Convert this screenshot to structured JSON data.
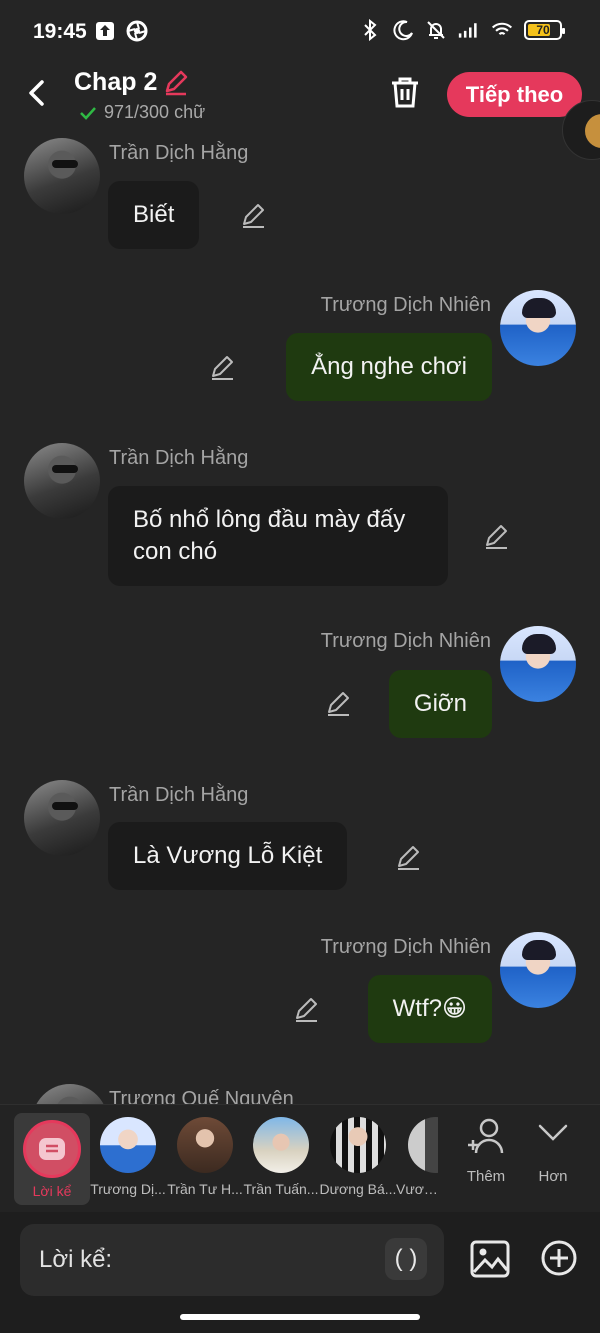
{
  "status_bar": {
    "time": "19:45",
    "battery": "70",
    "left_icons": [
      "upload-box-icon",
      "aperture-icon"
    ],
    "right_icons": [
      "bluetooth-icon",
      "moon-icon",
      "bell-off-icon",
      "signal-icon",
      "wifi-icon",
      "battery-icon"
    ]
  },
  "header": {
    "title": "Chap 2",
    "word_count": "971/300 chữ",
    "next_button": "Tiếp theo",
    "accent_color": "#e5395c"
  },
  "messages": [
    {
      "sender": "Trần Dịch Hằng",
      "side": "left",
      "text": "Biết"
    },
    {
      "sender": "Trương Dịch Nhiên",
      "side": "right",
      "text": "Ẳng nghe chơi"
    },
    {
      "sender": "Trần Dịch Hằng",
      "side": "left",
      "text": "Bố nhổ lông đầu mày đấy con chó"
    },
    {
      "sender": "Trương Dịch Nhiên",
      "side": "right",
      "text": "Giỡn"
    },
    {
      "sender": "Trần Dịch Hằng",
      "side": "left",
      "text": "Là Vương Lỗ Kiệt"
    },
    {
      "sender": "Trương Dịch Nhiên",
      "side": "right",
      "text": "Wtf?😀"
    },
    {
      "sender": "Trương Quế Nguyên",
      "side": "left",
      "text": ""
    }
  ],
  "character_bar": {
    "narrator_label": "Lời kể",
    "characters": [
      "Trương Dị...",
      "Trần Tư H...",
      "Trần Tuấn...",
      "Dương Bá...",
      "Vương"
    ],
    "add_label": "Thêm",
    "more_label": "Hơn"
  },
  "input": {
    "label": "Lời kể:",
    "paren_button": "( )"
  }
}
